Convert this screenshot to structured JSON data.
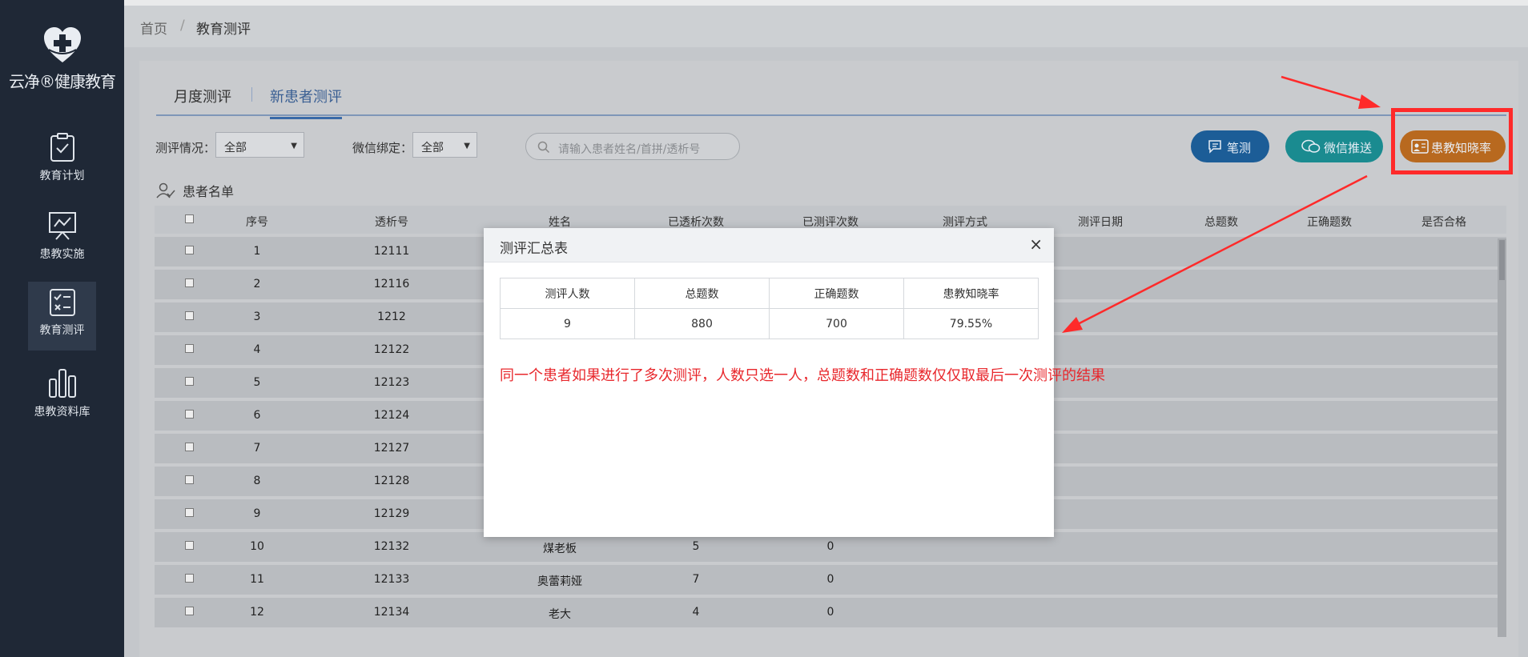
{
  "brand": {
    "name": "云净®健康教育"
  },
  "sidebar": {
    "items": [
      {
        "label": "教育计划",
        "icon": "clipboard-check-icon"
      },
      {
        "label": "患教实施",
        "icon": "presentation-board-icon"
      },
      {
        "label": "教育测评",
        "icon": "checklist-icon",
        "active": true
      },
      {
        "label": "患教资料库",
        "icon": "library-books-icon"
      }
    ]
  },
  "breadcrumb": {
    "home": "首页",
    "separator": "/",
    "current": "教育测评"
  },
  "tabs": [
    {
      "label": "月度测评",
      "active": false
    },
    {
      "label": "新患者测评",
      "active": true
    }
  ],
  "filters": {
    "status_label": "测评情况：",
    "status_value": "全部",
    "wechat_label": "微信绑定：",
    "wechat_value": "全部",
    "search_placeholder": "请输入患者姓名/首拼/透析号"
  },
  "buttons": {
    "written": "笔测",
    "wechat_push": "微信推送",
    "awareness_rate": "患教知晓率"
  },
  "list_title": "患者名单",
  "table": {
    "columns": [
      "序号",
      "透析号",
      "姓名",
      "已透析次数",
      "已测评次数",
      "测评方式",
      "测评日期",
      "总题数",
      "正确题数",
      "是否合格"
    ],
    "rows": [
      {
        "no": "1",
        "dialysis_no": "12111",
        "name": "",
        "dialysis_count": "",
        "eval_count": ""
      },
      {
        "no": "2",
        "dialysis_no": "12116",
        "name": "",
        "dialysis_count": "",
        "eval_count": ""
      },
      {
        "no": "3",
        "dialysis_no": "1212",
        "name": "",
        "dialysis_count": "",
        "eval_count": ""
      },
      {
        "no": "4",
        "dialysis_no": "12122",
        "name": "",
        "dialysis_count": "",
        "eval_count": ""
      },
      {
        "no": "5",
        "dialysis_no": "12123",
        "name": "",
        "dialysis_count": "",
        "eval_count": ""
      },
      {
        "no": "6",
        "dialysis_no": "12124",
        "name": "",
        "dialysis_count": "",
        "eval_count": ""
      },
      {
        "no": "7",
        "dialysis_no": "12127",
        "name": "",
        "dialysis_count": "",
        "eval_count": ""
      },
      {
        "no": "8",
        "dialysis_no": "12128",
        "name": "",
        "dialysis_count": "",
        "eval_count": ""
      },
      {
        "no": "9",
        "dialysis_no": "12129",
        "name": "",
        "dialysis_count": "",
        "eval_count": ""
      },
      {
        "no": "10",
        "dialysis_no": "12132",
        "name": "煤老板",
        "dialysis_count": "5",
        "eval_count": "0"
      },
      {
        "no": "11",
        "dialysis_no": "12133",
        "name": "奥蕾莉娅",
        "dialysis_count": "7",
        "eval_count": "0"
      },
      {
        "no": "12",
        "dialysis_no": "12134",
        "name": "老大",
        "dialysis_count": "4",
        "eval_count": "0"
      }
    ]
  },
  "modal": {
    "title": "测评汇总表",
    "close": "×",
    "headers": [
      "测评人数",
      "总题数",
      "正确题数",
      "患教知晓率"
    ],
    "values": [
      "9",
      "880",
      "700",
      "79.55%"
    ],
    "note": "同一个患者如果进行了多次测评，人数只选一人，总题数和正确题数仅仅取最后一次测评的结果"
  },
  "colors": {
    "annotation_red": "#ff2a2a",
    "sidebar_bg": "#1f2836"
  }
}
